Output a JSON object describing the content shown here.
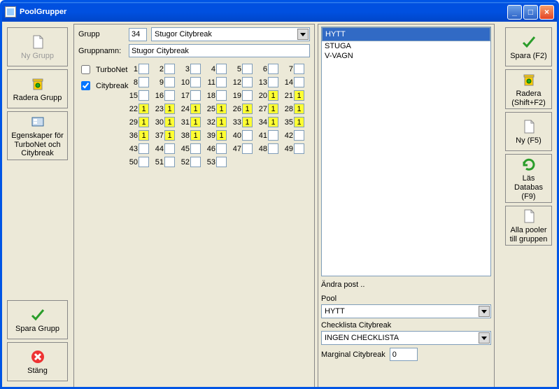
{
  "title": "PoolGrupper",
  "leftButtons": [
    {
      "name": "ny-grupp",
      "label": "Ny Grupp",
      "icon": "doc",
      "disabled": true
    },
    {
      "name": "radera-grupp",
      "label": "Radera Grupp",
      "icon": "trash-yellow"
    },
    {
      "name": "egenskaper",
      "label": "Egenskaper för TurboNet och Citybreak",
      "icon": "props"
    },
    {
      "name": "spara-grupp",
      "label": "Spara Grupp",
      "icon": "check-green"
    },
    {
      "name": "stang",
      "label": "Stäng",
      "icon": "close-red"
    }
  ],
  "rightButtons": [
    {
      "name": "spara-f2",
      "label": "Spara (F2)",
      "icon": "check-green"
    },
    {
      "name": "radera-shiftf2",
      "label": "Radera (Shift+F2)",
      "icon": "trash-green"
    },
    {
      "name": "ny-f5",
      "label": "Ny (F5)",
      "icon": "doc"
    },
    {
      "name": "las-databas",
      "label": "Läs Databas (F9)",
      "icon": "refresh"
    },
    {
      "name": "alla-pooler",
      "label": "Alla pooler till gruppen",
      "icon": "doc"
    }
  ],
  "form": {
    "gruppLabel": "Grupp",
    "gruppNum": "34",
    "gruppSelect": "Stugor Citybreak",
    "gruppnamnLabel": "Gruppnamn:",
    "gruppnamnValue": "Stugor Citybreak",
    "turbonetLabel": "TurboNet",
    "turbonetChecked": false,
    "citybreakLabel": "Citybreak",
    "citybreakChecked": true
  },
  "cells": [
    {
      "n": 1,
      "v": "",
      "y": false
    },
    {
      "n": 2,
      "v": "",
      "y": false
    },
    {
      "n": 3,
      "v": "",
      "y": false
    },
    {
      "n": 4,
      "v": "",
      "y": false
    },
    {
      "n": 5,
      "v": "",
      "y": false
    },
    {
      "n": 6,
      "v": "",
      "y": false
    },
    {
      "n": 7,
      "v": "",
      "y": false
    },
    {
      "n": 8,
      "v": "",
      "y": false
    },
    {
      "n": 9,
      "v": "",
      "y": false
    },
    {
      "n": 10,
      "v": "",
      "y": false
    },
    {
      "n": 11,
      "v": "",
      "y": false
    },
    {
      "n": 12,
      "v": "",
      "y": false
    },
    {
      "n": 13,
      "v": "",
      "y": false
    },
    {
      "n": 14,
      "v": "",
      "y": false
    },
    {
      "n": 15,
      "v": "",
      "y": false
    },
    {
      "n": 16,
      "v": "",
      "y": false
    },
    {
      "n": 17,
      "v": "",
      "y": false
    },
    {
      "n": 18,
      "v": "",
      "y": false
    },
    {
      "n": 19,
      "v": "",
      "y": false
    },
    {
      "n": 20,
      "v": "1",
      "y": true
    },
    {
      "n": 21,
      "v": "1",
      "y": true
    },
    {
      "n": 22,
      "v": "1",
      "y": true
    },
    {
      "n": 23,
      "v": "1",
      "y": true
    },
    {
      "n": 24,
      "v": "1",
      "y": true
    },
    {
      "n": 25,
      "v": "1",
      "y": true
    },
    {
      "n": 26,
      "v": "1",
      "y": true
    },
    {
      "n": 27,
      "v": "1",
      "y": true
    },
    {
      "n": 28,
      "v": "1",
      "y": true
    },
    {
      "n": 29,
      "v": "1",
      "y": true
    },
    {
      "n": 30,
      "v": "1",
      "y": true
    },
    {
      "n": 31,
      "v": "1",
      "y": true
    },
    {
      "n": 32,
      "v": "1",
      "y": true
    },
    {
      "n": 33,
      "v": "1",
      "y": true
    },
    {
      "n": 34,
      "v": "1",
      "y": true
    },
    {
      "n": 35,
      "v": "1",
      "y": true
    },
    {
      "n": 36,
      "v": "1",
      "y": true
    },
    {
      "n": 37,
      "v": "1",
      "y": true
    },
    {
      "n": 38,
      "v": "1",
      "y": true
    },
    {
      "n": 39,
      "v": "1",
      "y": true
    },
    {
      "n": 40,
      "v": "",
      "y": false
    },
    {
      "n": 41,
      "v": "",
      "y": false
    },
    {
      "n": 42,
      "v": "",
      "y": false
    },
    {
      "n": 43,
      "v": "",
      "y": false
    },
    {
      "n": 44,
      "v": "",
      "y": false
    },
    {
      "n": 45,
      "v": "",
      "y": false
    },
    {
      "n": 46,
      "v": "",
      "y": false
    },
    {
      "n": 47,
      "v": "",
      "y": false
    },
    {
      "n": 48,
      "v": "",
      "y": false
    },
    {
      "n": 49,
      "v": "",
      "y": false
    },
    {
      "n": 50,
      "v": "",
      "y": false
    },
    {
      "n": 51,
      "v": "",
      "y": false
    },
    {
      "n": 52,
      "v": "",
      "y": false
    },
    {
      "n": 53,
      "v": "",
      "y": false
    }
  ],
  "poolList": [
    "HYTT",
    "STUGA",
    "V-VAGN"
  ],
  "poolListSelected": 0,
  "andraPost": "Ändra post ..",
  "poolLabel": "Pool",
  "poolValue": "HYTT",
  "checklistaLabel": "Checklista Citybreak",
  "checklistaValue": "INGEN CHECKLISTA",
  "marginalLabel": "Marginal Citybreak",
  "marginalValue": "0"
}
